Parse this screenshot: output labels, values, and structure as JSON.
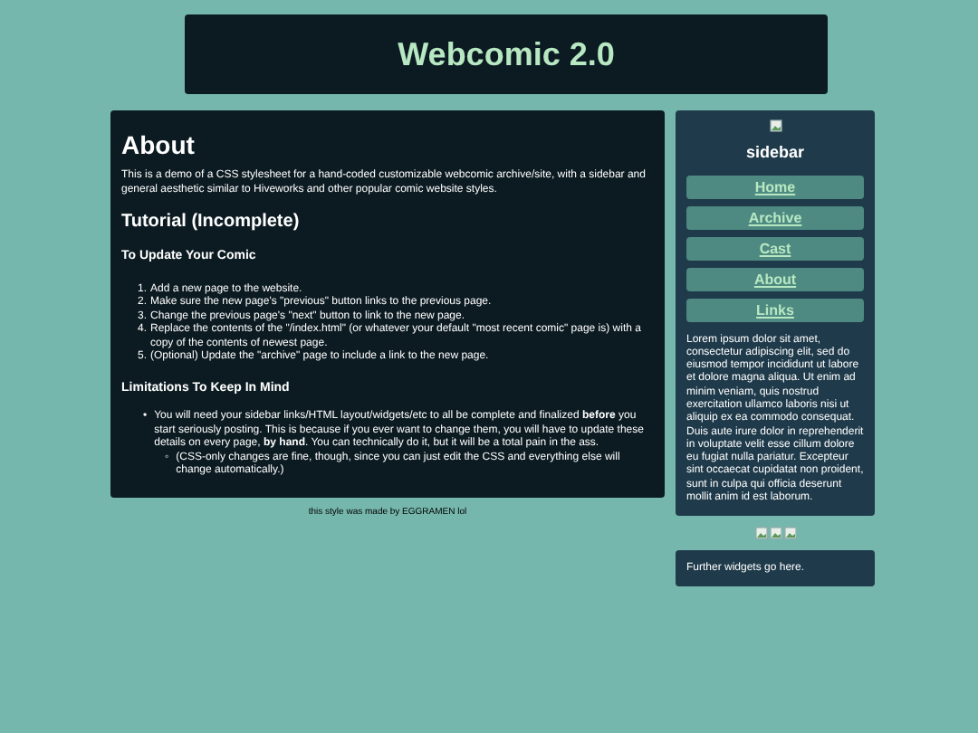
{
  "header": {
    "title": "Webcomic 2.0"
  },
  "main": {
    "heading": "About",
    "intro": "This is a demo of a CSS stylesheet for a hand-coded customizable webcomic archive/site, with a sidebar and general aesthetic similar to Hiveworks and other popular comic website styles.",
    "tutorial_heading": "Tutorial (Incomplete)",
    "update_heading": "To Update Your Comic",
    "steps": [
      {
        "number": "1.",
        "text": "Add a new page to the website."
      },
      {
        "number": "2.",
        "text": "Make sure the new page's \"previous\" button links to the previous page."
      },
      {
        "number": "3.",
        "text": "Change the previous page's \"next\" button to link to the new page."
      },
      {
        "number": "4.",
        "text": "Replace the contents of the \"/index.html\" (or whatever your default \"most recent comic\" page is) with a copy of the contents of newest page."
      },
      {
        "number": "5.",
        "text": "(Optional) Update the \"archive\" page to include a link to the new page."
      }
    ],
    "limits_heading": "Limitations To Keep In Mind",
    "limits": [
      {
        "marker": "•",
        "text": "You will need your sidebar links/HTML layout/widgets/etc to all be complete and finalized **before** you start seriously posting. This is because if you ever want to change them, you will have to update these details on every page, **by hand**. You can technically do it, but it will be a total pain in the ass.",
        "children": [
          {
            "marker": "◦",
            "text": "(CSS-only changes are fine, though, since you can just edit the CSS and everything else will change automatically.)"
          }
        ]
      }
    ]
  },
  "credit": "this style was made by EGGRAMEN lol",
  "sidebar": {
    "title": "sidebar",
    "links": [
      "Home",
      "Archive",
      "Cast",
      "About",
      "Links"
    ],
    "text": "Lorem ipsum dolor sit amet, consectetur adipiscing elit, sed do eiusmod tempor incididunt ut labore et dolore magna aliqua. Ut enim ad minim veniam, quis nostrud exercitation ullamco laboris nisi ut aliquip ex ea commodo consequat. Duis aute irure dolor in reprehenderit in voluptate velit esse cillum dolore eu fugiat nulla pariatur. Excepteur sint occaecat cupidatat non proident, sunt in culpa qui officia deserunt mollit anim id est laborum."
  },
  "widgets": {
    "text": "Further widgets go here."
  }
}
